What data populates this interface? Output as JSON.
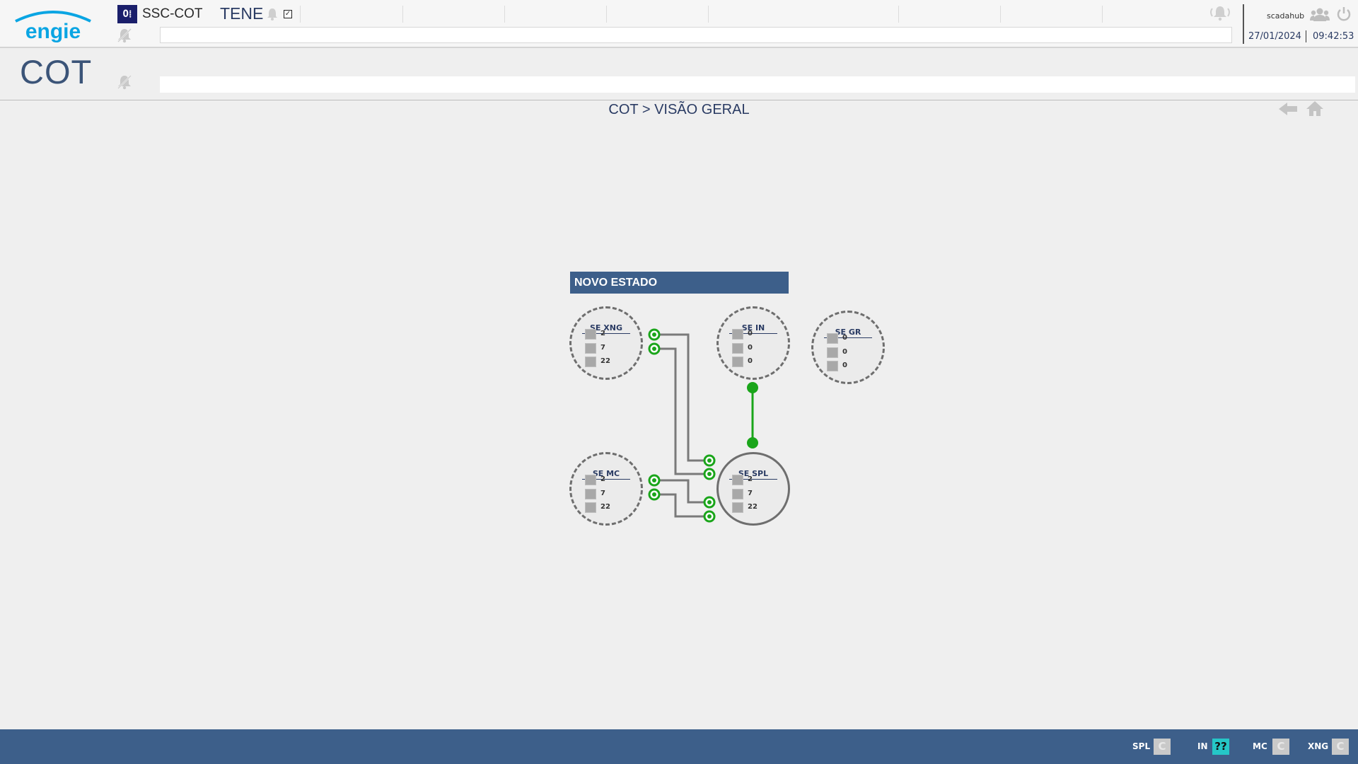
{
  "header": {
    "logo_text": "engie",
    "system_badge": "O⁞",
    "system_name": "SSC-COT",
    "user_group": "TENE",
    "ack_check": "✓",
    "username": "scadahub",
    "date": "27/01/2024",
    "time": "09:42:53"
  },
  "subheader": {
    "area_title": "COT"
  },
  "breadcrumb": "COT > VISÃO GERAL",
  "diagram": {
    "banner": "NOVO ESTADO",
    "nodes": [
      {
        "id": "xng",
        "title": "SE XNG",
        "values": [
          "2",
          "7",
          "22"
        ],
        "style": "dashed"
      },
      {
        "id": "in",
        "title": "SE IN",
        "values": [
          "0",
          "0",
          "0"
        ],
        "style": "dashed"
      },
      {
        "id": "gr",
        "title": "SE GR",
        "values": [
          "0",
          "0",
          "0"
        ],
        "style": "dashed"
      },
      {
        "id": "mc",
        "title": "SE MC",
        "values": [
          "2",
          "7",
          "22"
        ],
        "style": "dashed"
      },
      {
        "id": "spl",
        "title": "SE SPL",
        "values": [
          "2",
          "7",
          "22"
        ],
        "style": "solid"
      }
    ],
    "colors": {
      "link": "#7a7a7a",
      "connector": "#1aa51a",
      "ring": "#6e6e6e"
    }
  },
  "footer": {
    "status": [
      {
        "label": "SPL",
        "box": "C",
        "alert": false
      },
      {
        "label": "IN",
        "box": "??",
        "alert": true
      },
      {
        "label": "MC",
        "box": "C",
        "alert": false
      },
      {
        "label": "XNG",
        "box": "C",
        "alert": false
      }
    ]
  },
  "colors": {
    "brand": "#0aa5e3",
    "header_blue": "#3d5f8a",
    "title_blue": "#3b5478"
  }
}
